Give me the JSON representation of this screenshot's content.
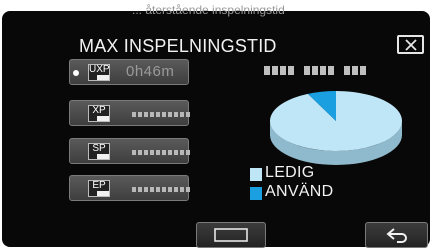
{
  "header": {
    "caption": "... återstående inspelningstid",
    "title": "MAX INSPELNINGSTID"
  },
  "modes": [
    {
      "code": "UXP",
      "value": "0h46m",
      "selected": true
    },
    {
      "code": "XP",
      "value": ""
    },
    {
      "code": "SP",
      "value": ""
    },
    {
      "code": "EP",
      "value": ""
    }
  ],
  "chart_data": {
    "type": "pie",
    "slices": [
      {
        "name": "LEDIG",
        "value": 93,
        "color": "#bfe6f6"
      },
      {
        "name": "ANVÄND",
        "value": 7,
        "color": "#1a9fe0"
      }
    ]
  },
  "legend": {
    "free_label": "LEDIG",
    "used_label": "ANVÄND"
  },
  "colors": {
    "free": "#bfe6f6",
    "used": "#1a9fe0",
    "panel": "#080808"
  },
  "icons": {
    "close": "close-x-icon",
    "rect": "rectangle-outline-icon",
    "back": "return-arrow-icon"
  }
}
